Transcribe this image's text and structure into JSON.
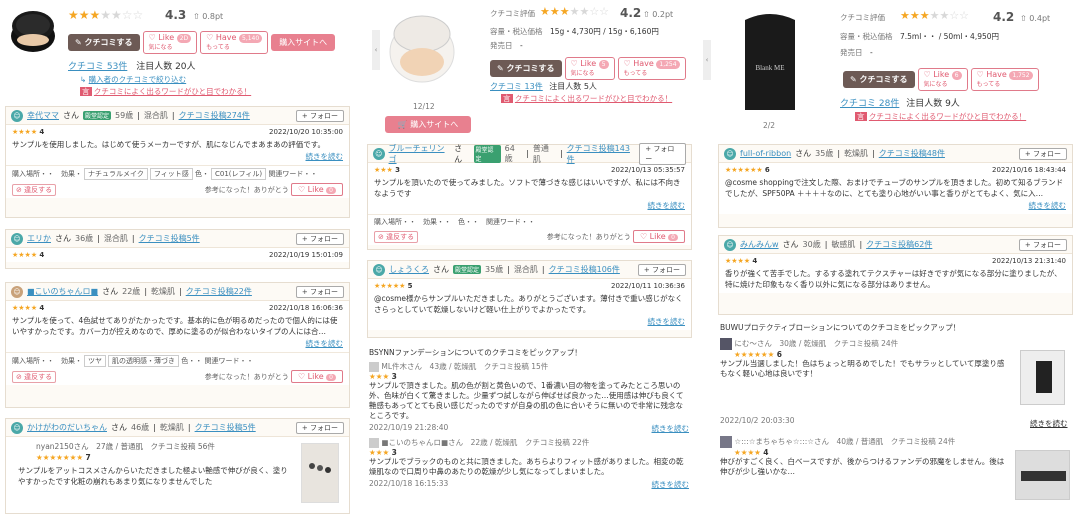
{
  "col1": {
    "rating": "4.3",
    "pt": "0.8pt",
    "btn_kuchikomi": "クチコミする",
    "btn_like": "Like",
    "btn_like_sub": "気になる",
    "like_count": "2D",
    "btn_have": "Have",
    "btn_have_sub": "もってる",
    "have_count": "5,140",
    "btn_buy": "購入サイトへ",
    "kuchikomi_count": "クチコミ 53件",
    "watchers": "注目人数 20人",
    "filter_link": "購入者のクチコミで絞り込む",
    "word_link": "クチコミによく出るワードがひと目でわかる！",
    "reviews": [
      {
        "name": "幸代ママ",
        "suffix": "さん",
        "badge": "殿堂認定",
        "age": "59歳",
        "skin": "混合肌",
        "posts": "クチコミ投稿274件",
        "stars": "★★★★",
        "score": "4",
        "date": "2022/10/20 10:35:00",
        "text": "サンプルを使用しました。はじめて使うメーカーですが、肌になじんでまあまあの評価です。",
        "more": "続きを読む",
        "tags_label": "購入場所・・　効果・",
        "tag1": "ナチュラルメイク",
        "tag2": "フィット感",
        "tag_color_label": "色・",
        "tag3": "C01(レフィル)",
        "tag_word": "関連ワード・・",
        "bad": "違反する",
        "thanks": "参考になった！ありがとう",
        "like": "Like",
        "like_n": "0",
        "follow": "+ フォロー"
      },
      {
        "name": "エリか",
        "suffix": "さん",
        "age": "36歳",
        "skin": "混合肌",
        "posts": "クチコミ投稿5件",
        "stars": "★★★★",
        "score": "4",
        "date": "2022/10/19 15:01:09",
        "follow": "+ フォロー"
      },
      {
        "name": "■こいのちゃんロ■",
        "suffix": "さん",
        "age": "22歳",
        "skin": "乾燥肌",
        "posts": "クチコミ投稿22件",
        "stars": "★★★★",
        "score": "4",
        "date": "2022/10/18 16:06:36",
        "text": "サンプルを使って、4色試せてありがたかったです。基本的に色が明るめだったので個人的には使いやすかったです。カバー力が控えめなので、厚めに塗るのが似合わないタイプの人には合…",
        "more": "続きを読む",
        "tags_label": "購入場所・・　効果・",
        "tag1": "ツヤ",
        "tag2": "肌の透明感・薄づき",
        "tag_color_label": "色・・",
        "tag_word": "関連ワード・・",
        "bad": "違反する",
        "thanks": "参考になった！ありがとう",
        "like": "Like",
        "like_n": "0",
        "follow": "+ フォロー"
      },
      {
        "name": "かけがわのだいちゃん",
        "suffix": "さん",
        "age": "46歳",
        "skin": "乾燥肌",
        "posts": "クチコミ投稿5件",
        "follow": "+ フォロー"
      }
    ],
    "mini": {
      "name": "nyan2150さん",
      "meta": "27歳 / 普通肌　クチコミ投稿 56件",
      "stars": "★★★★★★★",
      "score": "7",
      "text": "サンプルをアットコスメさんからいただきました極よい艶感で伸びが良く、塗りやすかったです化粧の崩れもあまり気になりませんでした"
    }
  },
  "col2": {
    "rating_label": "クチコミ評価",
    "rating": "4.2",
    "pt": "0.2pt",
    "spec_label": "容量・税込価格",
    "spec": "15g・4,730円 / 15g・6,160円",
    "release_label": "発売日",
    "release": "-",
    "btn_kuchikomi": "クチコミする",
    "btn_like": "Like",
    "btn_like_sub": "気になる",
    "like_count": "5",
    "btn_have": "Have",
    "btn_have_sub": "もってる",
    "have_count": "1,254",
    "kuchikomi_count": "クチコミ 13件",
    "watchers": "注目人数 5人",
    "word_link": "クチコミによく出るワードがひと目でわかる！",
    "pager": "12/12",
    "btn_buy": "購入サイトへ",
    "reviews": [
      {
        "name": "ブルーチェリンゴ",
        "suffix": "さん",
        "badge": "殿堂認定",
        "age": "64歳",
        "skin": "普通肌",
        "posts": "クチコミ投稿143件",
        "stars": "★★★",
        "score": "3",
        "date": "2022/10/13 05:35:57",
        "text": "サンプルを頂いたので使ってみました。ソフトで薄づきな感じはいいですが、私には不向きなようです",
        "more": "続きを読む",
        "tags": "購入場所・・　効果・・　色・・　関連ワード・・",
        "bad": "違反する",
        "thanks": "参考になった！ありがとう",
        "like": "Like",
        "like_n": "0",
        "follow": "+ フォロー"
      },
      {
        "name": "しょうくろ",
        "suffix": "さん",
        "badge": "殿堂認定",
        "age": "35歳",
        "skin": "混合肌",
        "posts": "クチコミ投稿106件",
        "stars": "★★★★★",
        "score": "5",
        "date": "2022/10/11 10:36:36",
        "text": "@cosme様からサンプルいただきました。ありがとうございます。薄付きで重い感じがなくさらっとしていて乾燥しないけど軽い仕上がりでよかったです。",
        "more": "続きを読む",
        "follow": "+ フォロー"
      }
    ],
    "pickup": "BSYNNファンデーションについてのクチコミをピックアップ！",
    "mini": [
      {
        "name": "ML件木さん",
        "meta": "43歳 / 乾燥肌　クチコミ投稿 15件",
        "stars": "★★★",
        "score": "3",
        "text": "サンプルで頂きました。肌の色が割と黄色いので、1番濃い目の物を塗ってみたところ思いの外、色味が白くて驚きました。少量ずつ試しながら伸ばせば良かった…使用感は伸びも良くて艶感もあってとても良い感じだったのですが自身の肌の色に合いそうに無いので非常に残念なところです。",
        "date": "2022/10/19 21:28:40",
        "more": "続きを読む"
      },
      {
        "name": "■こいのちゃんロ■さん",
        "meta": "22歳 / 乾燥肌　クチコミ投稿 22件",
        "stars": "★★★",
        "score": "3",
        "text": "サンプルでブラックのものと共に頂きました。あちらよりフィット感がありました。相変の乾燥肌なので口周り中鼻のあたりの乾燥が少し気になってしまいました。",
        "date": "2022/10/18 16:15:33",
        "more": "続きを読む"
      }
    ]
  },
  "col3": {
    "rating_label": "クチコミ評価",
    "rating": "4.2",
    "pt": "0.4pt",
    "spec_label": "容量・税込価格",
    "spec": "7.5ml・・ / 50ml・4,950円",
    "release_label": "発売日",
    "release": "-",
    "btn_kuchikomi": "クチコミする",
    "btn_like": "Like",
    "btn_like_sub": "気になる",
    "like_count": "6",
    "btn_have": "Have",
    "btn_have_sub": "もってる",
    "have_count": "1,752",
    "kuchikomi_count": "クチコミ 28件",
    "watchers": "注目人数 9人",
    "word_link": "クチコミによく出るワードがひと目でわかる！",
    "pager": "2/2",
    "product_text": "Blank ME",
    "reviews": [
      {
        "name": "full-of-ribbon",
        "suffix": "さん",
        "age": "35歳",
        "skin": "乾燥肌",
        "posts": "クチコミ投稿48件",
        "stars": "★★★★★★",
        "score": "6",
        "date": "2022/10/16 18:43:44",
        "text": "@cosme shoppingで注文した際、おまけでチューブのサンプルを頂きました。初めて知るブランドでしたが、SPF50PA ＋＋＋＋なのに、とても塗り心地がいい事と香りがとてもよく、気に入…",
        "more": "続きを読む",
        "follow": "+ フォロー"
      },
      {
        "name": "みんみんw",
        "suffix": "さん",
        "age": "30歳",
        "skin": "敏感肌",
        "posts": "クチコミ投稿62件",
        "stars": "★★★★",
        "score": "4",
        "date": "2022/10/13 21:31:40",
        "text": "香りが強くて苦手でした。するする塗れてテクスチャーは好きですが気になる部分に塗りましたが、特に焼けた印象もなく香り以外に気になる部分はありません。",
        "follow": "+ フォロー"
      }
    ],
    "pickup": "BUWUプロテクティブローションについてのクチコミをピックアップ！",
    "mini": [
      {
        "name": "にむ～さん",
        "meta": "30歳 / 乾燥肌　クチコミ投稿 24件",
        "stars": "★★★★★★",
        "score": "6",
        "text": "サンプル当選しました！色はちょっと明るめでした！でもサラッとしていて厚塗り感もなく軽い心地は良いです！",
        "date": "2022/10/2 20:03:30",
        "more": "続きを読む"
      },
      {
        "name": "☆:::☆まちゃちゃ☆:::☆さん",
        "meta": "40歳 / 普通肌　クチコミ投稿 24件",
        "stars": "★★★★",
        "score": "4",
        "text": "伸びがすごく良く、白ベースですが、後からつけるファンデの邪魔をしません。後は伸びが少し強いかな…"
      }
    ]
  }
}
